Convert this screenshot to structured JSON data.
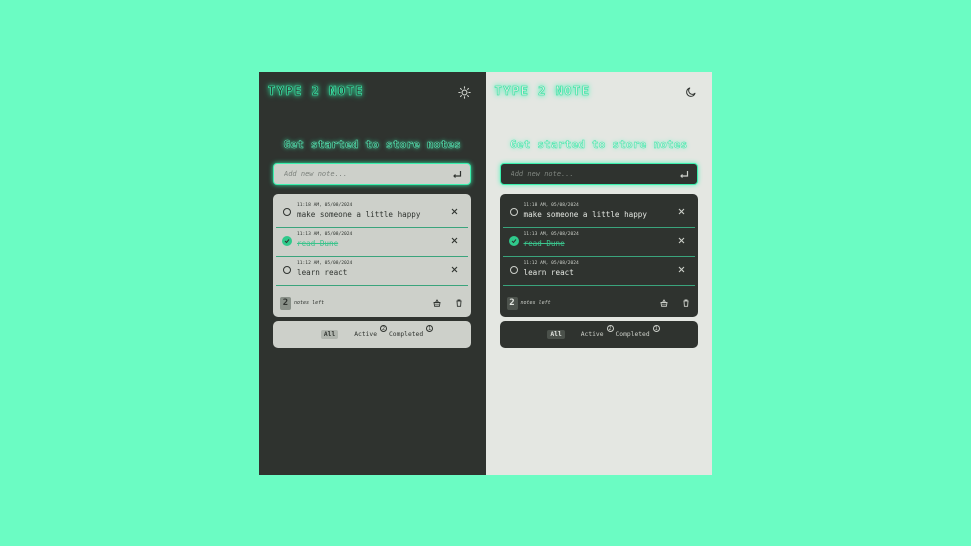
{
  "app": {
    "brand": "TYPE 2 NOTE",
    "heading": "Get started to store notes",
    "new_note_placeholder": "Add new note..."
  },
  "notes": [
    {
      "time": "11:18 AM, 05/08/2024",
      "text": "make someone a little happy",
      "completed": false
    },
    {
      "time": "11:13 AM, 05/08/2024",
      "text": "read Dune",
      "completed": true
    },
    {
      "time": "11:12 AM, 05/08/2024",
      "text": "learn react",
      "completed": false
    }
  ],
  "footer": {
    "count": "2",
    "count_label": "notes left"
  },
  "filters": {
    "all": "All",
    "active": "Active",
    "active_count": "2",
    "completed": "Completed",
    "completed_count": "1"
  },
  "themes": {
    "dark_panel_toggle_icon": "sun-icon",
    "light_panel_toggle_icon": "moon-icon"
  },
  "colors": {
    "background": "#6bfcc3",
    "dark_bg": "#2f332f",
    "light_bg": "#e4e7e2",
    "accent": "#3cf0ae"
  }
}
